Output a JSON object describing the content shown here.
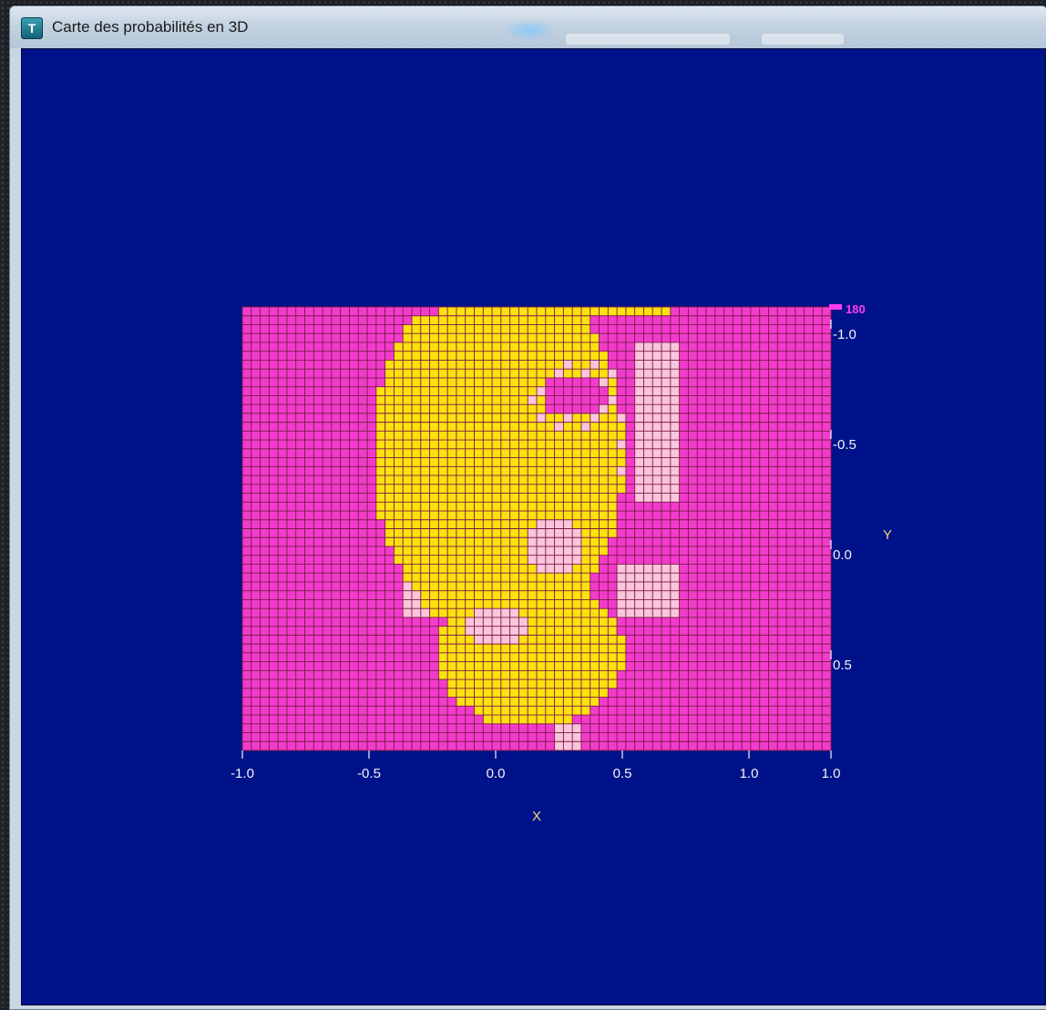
{
  "window": {
    "title": "Carte des probabilités en 3D",
    "icon": "app-icon"
  },
  "chart_data": {
    "type": "heatmap",
    "title": "",
    "xlabel": "X",
    "ylabel": "Y",
    "x_ticks": [
      "-1.0",
      "-0.5",
      "0.0",
      "0.5",
      "1.0",
      "1.0"
    ],
    "y_ticks": [
      "-1.0",
      "-0.5",
      "0.0",
      "0.5"
    ],
    "colorbar_label": "180",
    "grid_size": [
      66,
      50
    ],
    "colors": {
      "background": "#00128a",
      "low": "#f23bcc",
      "mid": "#fbc5dc",
      "high": "#fce10e",
      "grid_line": "#7a1a46",
      "tick_text": "#f3f3f3",
      "axis_letter": "#f3d870",
      "colorbar_text": "#ff3cf0"
    }
  }
}
